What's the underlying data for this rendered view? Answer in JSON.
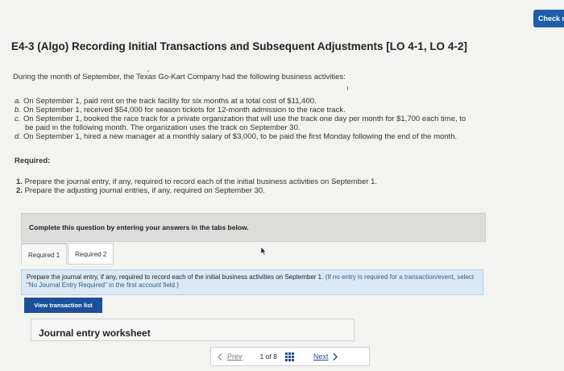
{
  "header": {
    "check_label": "Check m"
  },
  "problem": {
    "title": "E4-3 (Algo) Recording Initial Transactions and Subsequent Adjustments [LO 4-1, LO 4-2]",
    "intro": "During the month of September, the Texas Go-Kart Company had the following business activities:",
    "activities": [
      {
        "letter": "a.",
        "lines": [
          "On September 1, paid rent on the track facility for six months at a total cost of $11,400."
        ]
      },
      {
        "letter": "b.",
        "lines": [
          "On September 1, received $54,000 for season tickets for 12-month admission to the race track."
        ]
      },
      {
        "letter": "c.",
        "lines": [
          "On September 1, booked the race track for a private organization that will use the track one day per month for $1,700 each time, to",
          "be paid in the following month. The organization uses the track on September 30."
        ]
      },
      {
        "letter": "d.",
        "lines": [
          "On September 1, hired a new manager at a monthly salary of $3,000, to be paid the first Monday following the end of the month."
        ]
      }
    ],
    "required_heading": "Required:",
    "requirements": [
      {
        "num": "1.",
        "text": "Prepare the journal entry, if any, required to record each of the initial business activities on September 1."
      },
      {
        "num": "2.",
        "text": "Prepare the adjusting journal entries, if any, required on September 30."
      }
    ]
  },
  "answer": {
    "complete_text": "Complete this question by entering your answers in the tabs below.",
    "tabs": [
      {
        "label": "Required 1",
        "active": true
      },
      {
        "label": "Required 2",
        "active": false
      }
    ],
    "instruction": "Prepare the journal entry, if any, required to record each of the initial business activities on September 1.",
    "instruction_hint": "(If no entry is required for a transaction/event, select \"No Journal Entry Required\" in the first account field.)",
    "view_transaction_label": "View transaction list",
    "worksheet_title": "Journal entry worksheet"
  },
  "pager": {
    "prev_label": "Prev",
    "page_current": "1",
    "page_of": "of",
    "page_total": "8",
    "next_label": "Next"
  }
}
